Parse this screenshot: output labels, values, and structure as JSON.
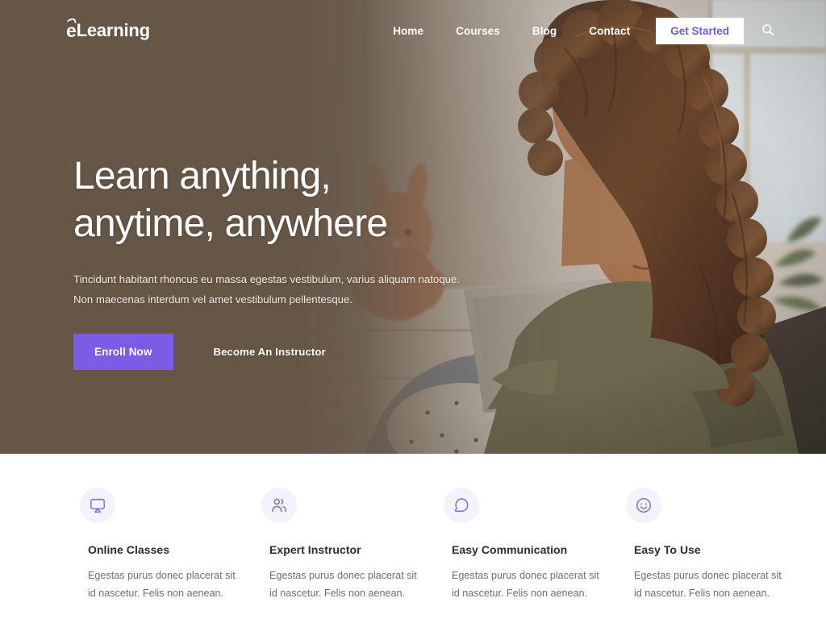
{
  "brand": {
    "logo_e": "e",
    "logo_text": "Learning",
    "accent_purple": "#7b5ce6",
    "overlay_brown": "#655646"
  },
  "nav": {
    "links": [
      {
        "label": "Home",
        "name": "nav-link-home"
      },
      {
        "label": "Courses",
        "name": "nav-link-courses"
      },
      {
        "label": "Blog",
        "name": "nav-link-blog"
      },
      {
        "label": "Contact",
        "name": "nav-link-contact"
      }
    ],
    "cta_label": "Get Started",
    "search_icon": "search-icon"
  },
  "hero": {
    "title_line1": "Learn anything,",
    "title_line2": "anytime, anywhere",
    "subtitle": "Tincidunt habitant rhoncus eu massa egestas vestibulum, varius aliquam natoque. Non maecenas interdum vel amet vestibulum pellentesque.",
    "primary_cta": "Enroll Now",
    "secondary_cta": "Become An Instructor"
  },
  "features": [
    {
      "icon": "screen-share-icon",
      "title": "Online Classes",
      "desc": "Egestas purus donec placerat sit id nascetur. Felis non aenean."
    },
    {
      "icon": "users-icon",
      "title": "Expert Instructor",
      "desc": "Egestas purus donec placerat sit id nascetur. Felis non aenean."
    },
    {
      "icon": "chat-bubble-icon",
      "title": "Easy Communication",
      "desc": "Egestas purus donec placerat sit id nascetur. Felis non aenean."
    },
    {
      "icon": "smiley-face-icon",
      "title": "Easy To Use",
      "desc": "Egestas purus donec placerat sit id nascetur. Felis non aenean."
    }
  ]
}
